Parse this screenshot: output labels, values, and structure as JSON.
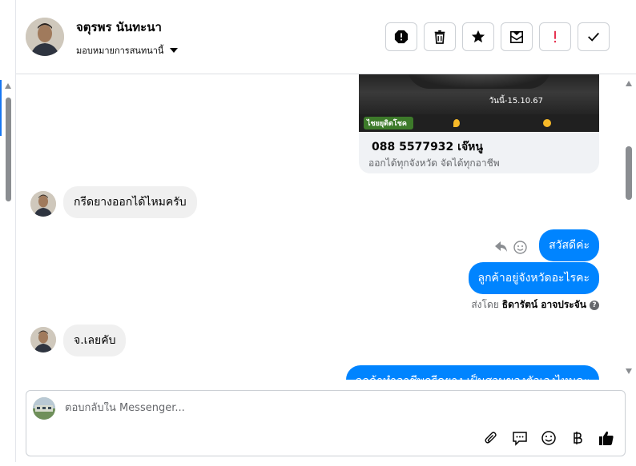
{
  "header": {
    "contact_name": "จตุรพร นันทะนา",
    "assign_label": "มอบหมายการสนทนานี้",
    "actions": [
      {
        "name": "report-button",
        "icon": "alert-octagon-icon"
      },
      {
        "name": "delete-button",
        "icon": "trash-icon"
      },
      {
        "name": "star-button",
        "icon": "star-icon"
      },
      {
        "name": "mark-unread-button",
        "icon": "envelope-icon"
      },
      {
        "name": "follow-up-button",
        "icon": "exclamation-icon"
      },
      {
        "name": "mark-done-button",
        "icon": "check-icon"
      }
    ]
  },
  "card": {
    "image_date": "วันนี้-15.10.67",
    "image_logo": "ไชยยุติตโชค",
    "title": "088 5577932 เจ๊หนู",
    "subtitle": "ออกได้ทุกจังหวัด จัดได้ทุกอาชีพ"
  },
  "messages": {
    "in_1": "กรีดยางออกได้ไหมครับ",
    "out_1": "สวัสดีค่ะ",
    "out_2": "ลูกค้าอยู่จังหวัดอะไรคะ",
    "sent_by_prefix": "ส่งโดย",
    "sent_by_name": "ธิดารัตน์ อาจประจัน",
    "in_2": "จ.เลยคับ",
    "out_3_partial": "ลูกค้าทำอาชีพกรีดยาง เป็นสวนของตัวเองไหมคะ"
  },
  "composer": {
    "placeholder": "ตอบกลับใน Messenger...",
    "tools": [
      "paperclip-icon",
      "speech-bubble-icon",
      "smile-icon",
      "baht-icon",
      "thumbs-up-icon"
    ]
  },
  "colors": {
    "accent": "#0084ff",
    "incoming_bubble": "#f0f0f0",
    "secondary_text": "#65676b"
  }
}
